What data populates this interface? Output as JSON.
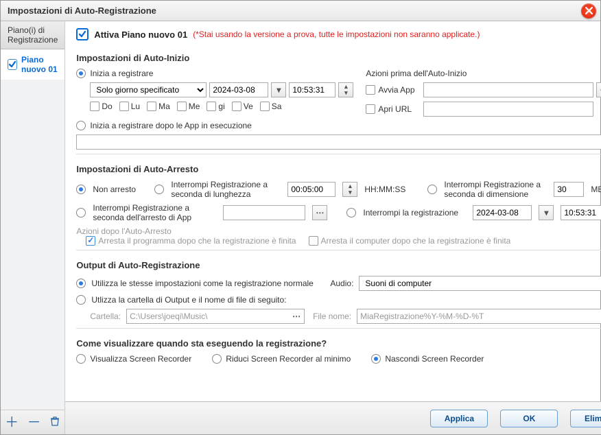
{
  "window": {
    "title": "Impostazioni di Auto-Registrazione"
  },
  "sidebar": {
    "header": "Piano(i) di Registrazione",
    "items": [
      {
        "label": "Piano nuovo 01",
        "checked": true,
        "selected": true
      }
    ]
  },
  "activate": {
    "label": "Attiva Piano nuovo 01",
    "warning": "(*Stai usando la versione a prova, tutte le impostazioni non saranno applicate.)"
  },
  "autostart": {
    "title": "Impostazioni di Auto-Inizio",
    "start_label": "Inizia a registrare",
    "mode": "Solo giorno specificato",
    "date": "2024-03-08",
    "time": "10:53:31",
    "days": {
      "Do": "Do",
      "Lu": "Lu",
      "Ma": "Ma",
      "Me": "Me",
      "gi": "gi",
      "Ve": "Ve",
      "Sa": "Sa"
    },
    "before_title": "Azioni prima dell'Auto-Inizio",
    "launch_app": "Avvia App",
    "open_url": "Apri URL",
    "launch_app_value": "",
    "open_url_value": "",
    "start_after_apps": "Inizia a registrare dopo le App in esecuzione",
    "apps_value": ""
  },
  "autostop": {
    "title": "Impostazioni di Auto-Arresto",
    "no_stop": "Non arresto",
    "by_length": "Interrompi Registrazione a seconda di lunghezza",
    "length_value": "00:05:00",
    "length_unit": "HH:MM:SS",
    "by_size": "Interrompi Registrazione a seconda di dimensione",
    "size_value": "30",
    "size_unit": "MB",
    "by_app": "Interrompi Registrazione a seconda dell'arresto di App",
    "app_value": "",
    "by_time": "Interrompi la registrazione",
    "stop_date": "2024-03-08",
    "stop_time": "10:53:31",
    "after_title": "Azioni dopo l'Auto-Arresto",
    "close_program": "Arresta il programma dopo che la registrazione è finita",
    "shutdown_pc": "Arresta il computer dopo che la registrazione è finita"
  },
  "output": {
    "title": "Output di Auto-Registrazione",
    "same_settings": "Utilizza le stesse impostazioni come la registrazione normale",
    "audio_label": "Audio:",
    "audio_value": "Suoni di computer",
    "custom_output": "Utlizza la cartella di Output e il nome di file di seguito:",
    "folder_label": "Cartella:",
    "folder_value": "C:\\Users\\joeqi\\Music\\",
    "filename_label": "File nome:",
    "filename_value": "MiaRegistrazione%Y-%M-%D-%T"
  },
  "display": {
    "title": "Come visualizzare quando sta eseguendo la registrazione?",
    "show": "Visualizza Screen Recorder",
    "minimize": "Riduci Screen Recorder al minimo",
    "hide": "Nascondi Screen Recorder"
  },
  "footer": {
    "apply": "Applica",
    "ok": "OK",
    "delete": "Elimina"
  }
}
